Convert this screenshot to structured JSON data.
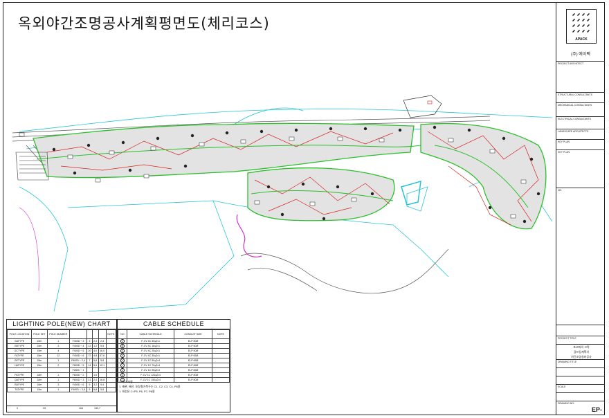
{
  "title": "옥외야간조명공사계획평면도(체리코스)",
  "company": {
    "logo_text": "APACK",
    "name": "(주) 에이팩"
  },
  "title_block": {
    "rows": [
      "PROJECT ARCHITECT",
      "STRUCTURAL CONSULTANTS",
      "MECHANICAL CONSULTANTS",
      "ELECTRICAL CONSULTANTS",
      "LANDSCAPE ARCHITECTS",
      "KEY PLAN",
      "NO.",
      "PROJECT TITLE",
      "DRAWING TITLE",
      "SCALE",
      "DRAWING NO."
    ],
    "project_lines": [
      "포코파의 크락",
      "골프장계획의",
      "야간조명설비공사"
    ],
    "drawing_no": "EP-"
  },
  "lighting_chart": {
    "title": "LIGHTING POLE(NEW) CHART",
    "headers": [
      "POLE LOCATION",
      "POLE SET",
      "POLE NUMBER",
      "",
      "",
      "",
      "",
      "",
      "NOTE"
    ],
    "rows": [
      [
        "GATYPE",
        "15m",
        "1",
        "F400D ÷ 3",
        "3",
        "2,4",
        "2,4"
      ],
      [
        "GBTYPE",
        "15m",
        "3",
        "F400D ÷ 4",
        "12",
        "1,2",
        "5,5"
      ],
      [
        "GCTYPE",
        "15m",
        "4",
        "F400D ÷ 5",
        "20",
        "4,0",
        "16,0"
      ],
      [
        "FATYPE",
        "15m",
        "12",
        "F400D ÷ 6",
        "72",
        "4,8",
        "57,6"
      ],
      [
        "GETYPE",
        "15m",
        "1",
        "F600D ÷ 2,4",
        "7",
        "5,8",
        "5,8"
      ],
      [
        "HATYPE",
        "15m",
        "2",
        "F600D ÷ 5",
        "14",
        "5,0",
        "10,1"
      ],
      [
        "",
        "",
        "",
        "F280C ÷ 1",
        "",
        "",
        ""
      ],
      [
        "PATYPE",
        "18m",
        "1",
        "F600D ÷ 2",
        "",
        "1,6",
        ""
      ],
      [
        "QATYPE",
        "18m",
        "1",
        "F600D ÷ 3",
        "21",
        "2,4",
        "16,8"
      ],
      [
        "RATYPE",
        "16m",
        "3",
        "F400D ÷ 6",
        "9",
        "3,2",
        "9,4"
      ],
      [
        "TATYPE",
        "15m",
        "1",
        "F400D ÷ 3,6",
        "5",
        "5,8",
        "5,8"
      ]
    ],
    "totals": [
      "0",
      "33",
      "164",
      "130,7"
    ]
  },
  "cable_schedule": {
    "title": "CABLE SCHEDULE",
    "headers": [
      "NO",
      "CABLE SCHEDULE",
      "CONDUIT SIZE",
      "NOTE"
    ],
    "rows": [
      [
        "A",
        "F-CV 4C 35㎟×1",
        "ELP 80Ø",
        ""
      ],
      [
        "B",
        "F-CV 4C 16㎟×1",
        "ELP 50Ø",
        ""
      ],
      [
        "C",
        "F-CV 4C 25㎟×1",
        "ELP 50Ø",
        ""
      ],
      [
        "D",
        "F-CV 4C 35㎟×1",
        "ELP 65Ø",
        ""
      ],
      [
        "E",
        "F-CV 1C 50㎟×4",
        "ELP 65Ø",
        ""
      ],
      [
        "F",
        "F-CV 1C 70㎟×4",
        "ELP 65Ø",
        ""
      ],
      [
        "G",
        "F-CV 1C 95㎟×4",
        "ELP 65Ø",
        ""
      ],
      [
        "H",
        "F-CV 1C 120㎟×4",
        "ELP 80Ø",
        ""
      ],
      [
        "I",
        "F-CV 1C 150㎟×4",
        "ELP 80Ø",
        ""
      ]
    ],
    "notes_title": "※ 주기사항",
    "notes": [
      "1. 배관, 배선, 포장철거복구는 C1, C2, C3, C4, P8용",
      "1. 회선은 C=P5, P6, P7, P8용"
    ]
  },
  "colors": {
    "fairway_outline": "#2bbf2b",
    "cable": "#d62020",
    "boundary": "#25c5d8",
    "road": "#555555",
    "magenta": "#cc33cc"
  }
}
